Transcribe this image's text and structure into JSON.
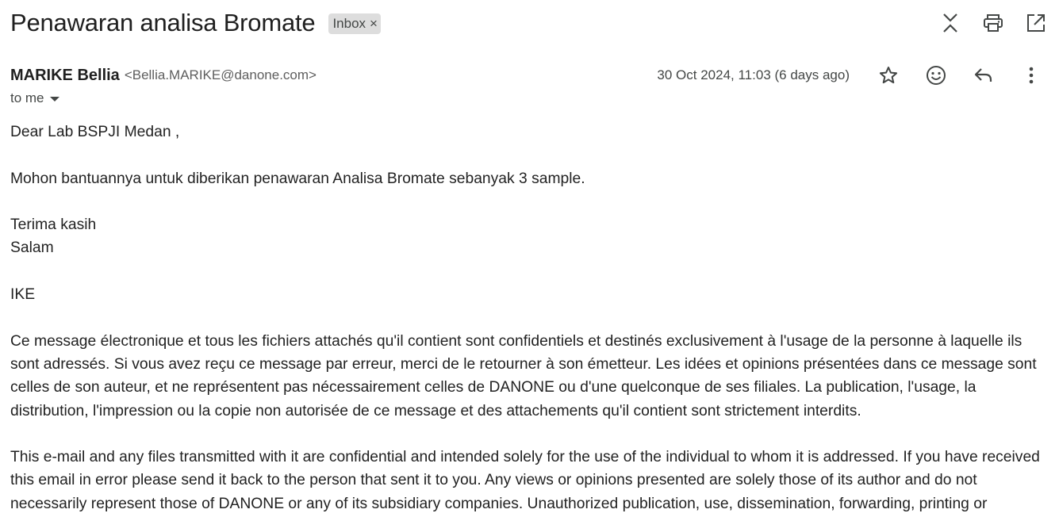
{
  "email": {
    "subject": "Penawaran analisa Bromate",
    "label": "Inbox",
    "label_close": "×",
    "sender": {
      "name": "MARIKE Bellia",
      "email": "<Bellia.MARIKE@danone.com>"
    },
    "date": "30 Oct 2024, 11:03 (6 days ago)",
    "to": "to me",
    "body": {
      "greeting": "Dear Lab BSPJI Medan ,",
      "line1": "Mohon bantuannya untuk diberikan penawaran Analisa Bromate sebanyak 3 sample.",
      "closing1": "Terima kasih",
      "closing2": "Salam",
      "signature": "IKE",
      "disclaimer_fr": "Ce message électronique et tous les fichiers attachés qu'il contient sont confidentiels et destinés exclusivement à l'usage de la personne à laquelle ils sont adressés. Si vous avez reçu ce message par erreur, merci de le retourner à son émetteur. Les idées et opinions présentées dans ce message sont celles de son auteur, et ne représentent pas nécessairement celles de DANONE ou d'une quelconque de ses filiales. La publication, l'usage, la distribution, l'impression ou la copie non autorisée de ce message et des attachements qu'il contient sont strictement interdits.",
      "disclaimer_en": "This e-mail and any files transmitted with it are confidential and intended solely for the use of the individual to whom it is addressed. If you have received this email in error please send it back to the person that sent it to you. Any views or opinions presented are solely those of its author and do not necessarily represent those of DANONE or any of its subsidiary companies. Unauthorized publication, use, dissemination, forwarding, printing or"
    }
  },
  "icons": {
    "collapse": "collapse-all-icon",
    "print": "print-icon",
    "open_new": "open-in-new-window-icon",
    "star": "star-icon",
    "emoji": "emoji-reaction-icon",
    "reply": "reply-icon",
    "more": "more-vertical-icon"
  },
  "colors": {
    "text": "#1f1f1f",
    "secondary": "#444746",
    "chip_bg": "#dddddd"
  }
}
